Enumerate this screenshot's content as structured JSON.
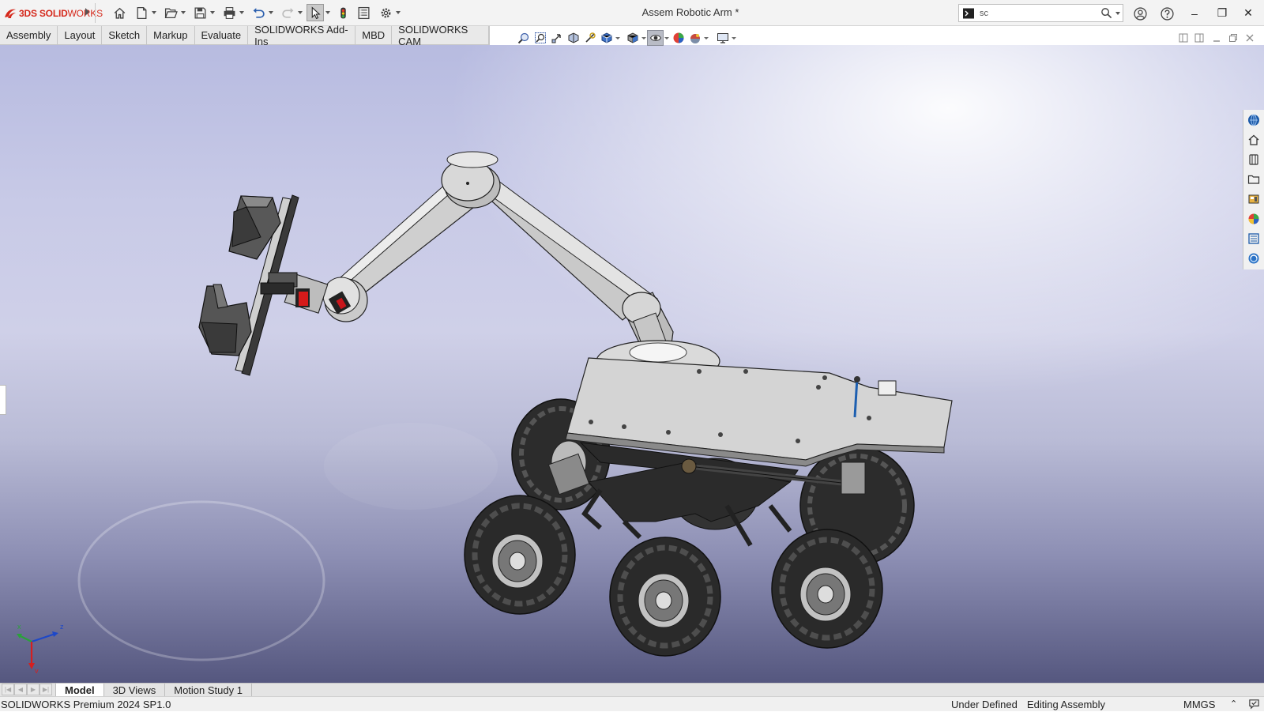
{
  "app": {
    "brand_bold": "3DS SOLID",
    "brand_thin": "WORKS",
    "document_title": "Assem Robotic Arm *"
  },
  "search": {
    "value": "sc"
  },
  "window_controls": {
    "minimize": "–",
    "restore": "❐",
    "close": "✕"
  },
  "command_tabs": [
    "Assembly",
    "Layout",
    "Sketch",
    "Markup",
    "Evaluate",
    "SOLIDWORKS Add-Ins",
    "MBD",
    "SOLIDWORKS CAM"
  ],
  "bottom_tabs": [
    "Model",
    "3D Views",
    "Motion Study 1"
  ],
  "active_bottom_tab": "Model",
  "triad": {
    "x": "x",
    "y": "y",
    "z": "z"
  },
  "status": {
    "product": "SOLIDWORKS Premium 2024 SP1.0",
    "definition": "Under Defined",
    "mode": "Editing Assembly",
    "units": "MMGS",
    "units_arrow": "⌃"
  },
  "colors": {
    "brand_red": "#d5281b",
    "model_gray": "#c9c9c9",
    "tire_dark": "#2c2c2c",
    "accent_blue": "#1d5fb0"
  },
  "icons": {
    "quick_access": [
      "home-icon",
      "new-document-icon",
      "open-icon",
      "save-icon",
      "print-icon",
      "undo-icon",
      "redo-icon",
      "select-icon",
      "rebuild-icon",
      "file-properties-icon",
      "options-icon"
    ],
    "task_pane": [
      "solidworks-resources-icon",
      "home-icon",
      "design-library-icon",
      "file-explorer-icon",
      "view-palette-icon",
      "appearances-icon",
      "custom-properties-icon",
      "forum-icon"
    ]
  }
}
